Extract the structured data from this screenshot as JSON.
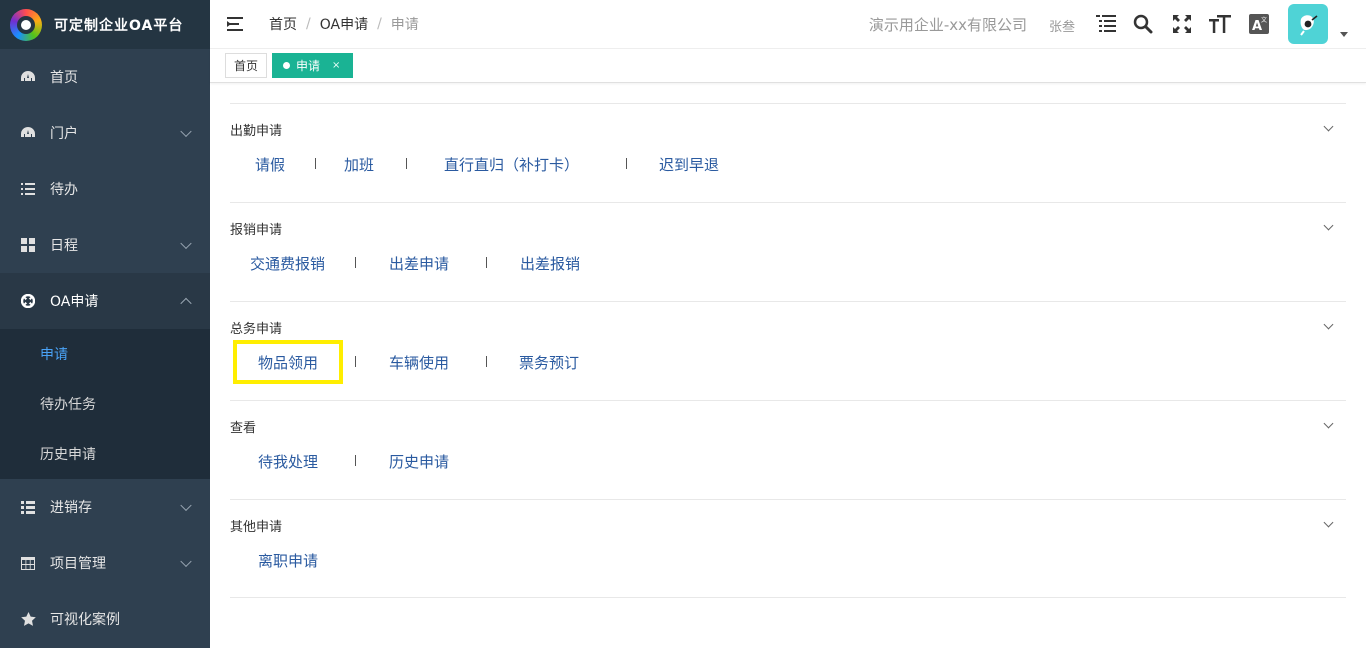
{
  "app": {
    "title": "可定制企业OA平台"
  },
  "sidebar": {
    "items": [
      {
        "label": "首页",
        "icon": "dashboard-icon"
      },
      {
        "label": "门户",
        "icon": "dashboard-icon",
        "chevron": "down"
      },
      {
        "label": "待办",
        "icon": "list-icon"
      },
      {
        "label": "日程",
        "icon": "grid-icon",
        "chevron": "down"
      },
      {
        "label": "OA申请",
        "icon": "lifebuoy-icon",
        "chevron": "up"
      },
      {
        "label": "进销存",
        "icon": "list-alt-icon",
        "chevron": "down"
      },
      {
        "label": "项目管理",
        "icon": "table-icon",
        "chevron": "down"
      },
      {
        "label": "可视化案例",
        "icon": "star-icon"
      }
    ],
    "submenu": [
      {
        "label": "申请"
      },
      {
        "label": "待办任务"
      },
      {
        "label": "历史申请"
      }
    ]
  },
  "header": {
    "breadcrumb": [
      "首页",
      "OA申请",
      "申请"
    ],
    "separator": "/",
    "company": "演示用企业-xx有限公司",
    "username": "张叁",
    "icons": [
      "menu-list-icon",
      "search-icon",
      "fullscreen-icon",
      "font-size-icon",
      "translate-icon"
    ]
  },
  "tabs": {
    "home": "首页",
    "active": "申请",
    "close": "×"
  },
  "sections": [
    {
      "title": "出勤申请",
      "links": [
        "请假",
        "加班",
        "直行直归（补打卡）",
        "迟到早退"
      ]
    },
    {
      "title": "报销申请",
      "links": [
        "交通费报销",
        "出差申请",
        "出差报销"
      ]
    },
    {
      "title": "总务申请",
      "links": [
        "物品领用",
        "车辆使用",
        "票务预订"
      ]
    },
    {
      "title": "查看",
      "links": [
        "待我处理",
        "历史申请"
      ]
    },
    {
      "title": "其他申请",
      "links": [
        "离职申请"
      ]
    }
  ],
  "colors": {
    "sidebar": "#2f4050",
    "accent": "#1ab394",
    "link": "#2a5aa0",
    "highlight": "#ffee00"
  }
}
